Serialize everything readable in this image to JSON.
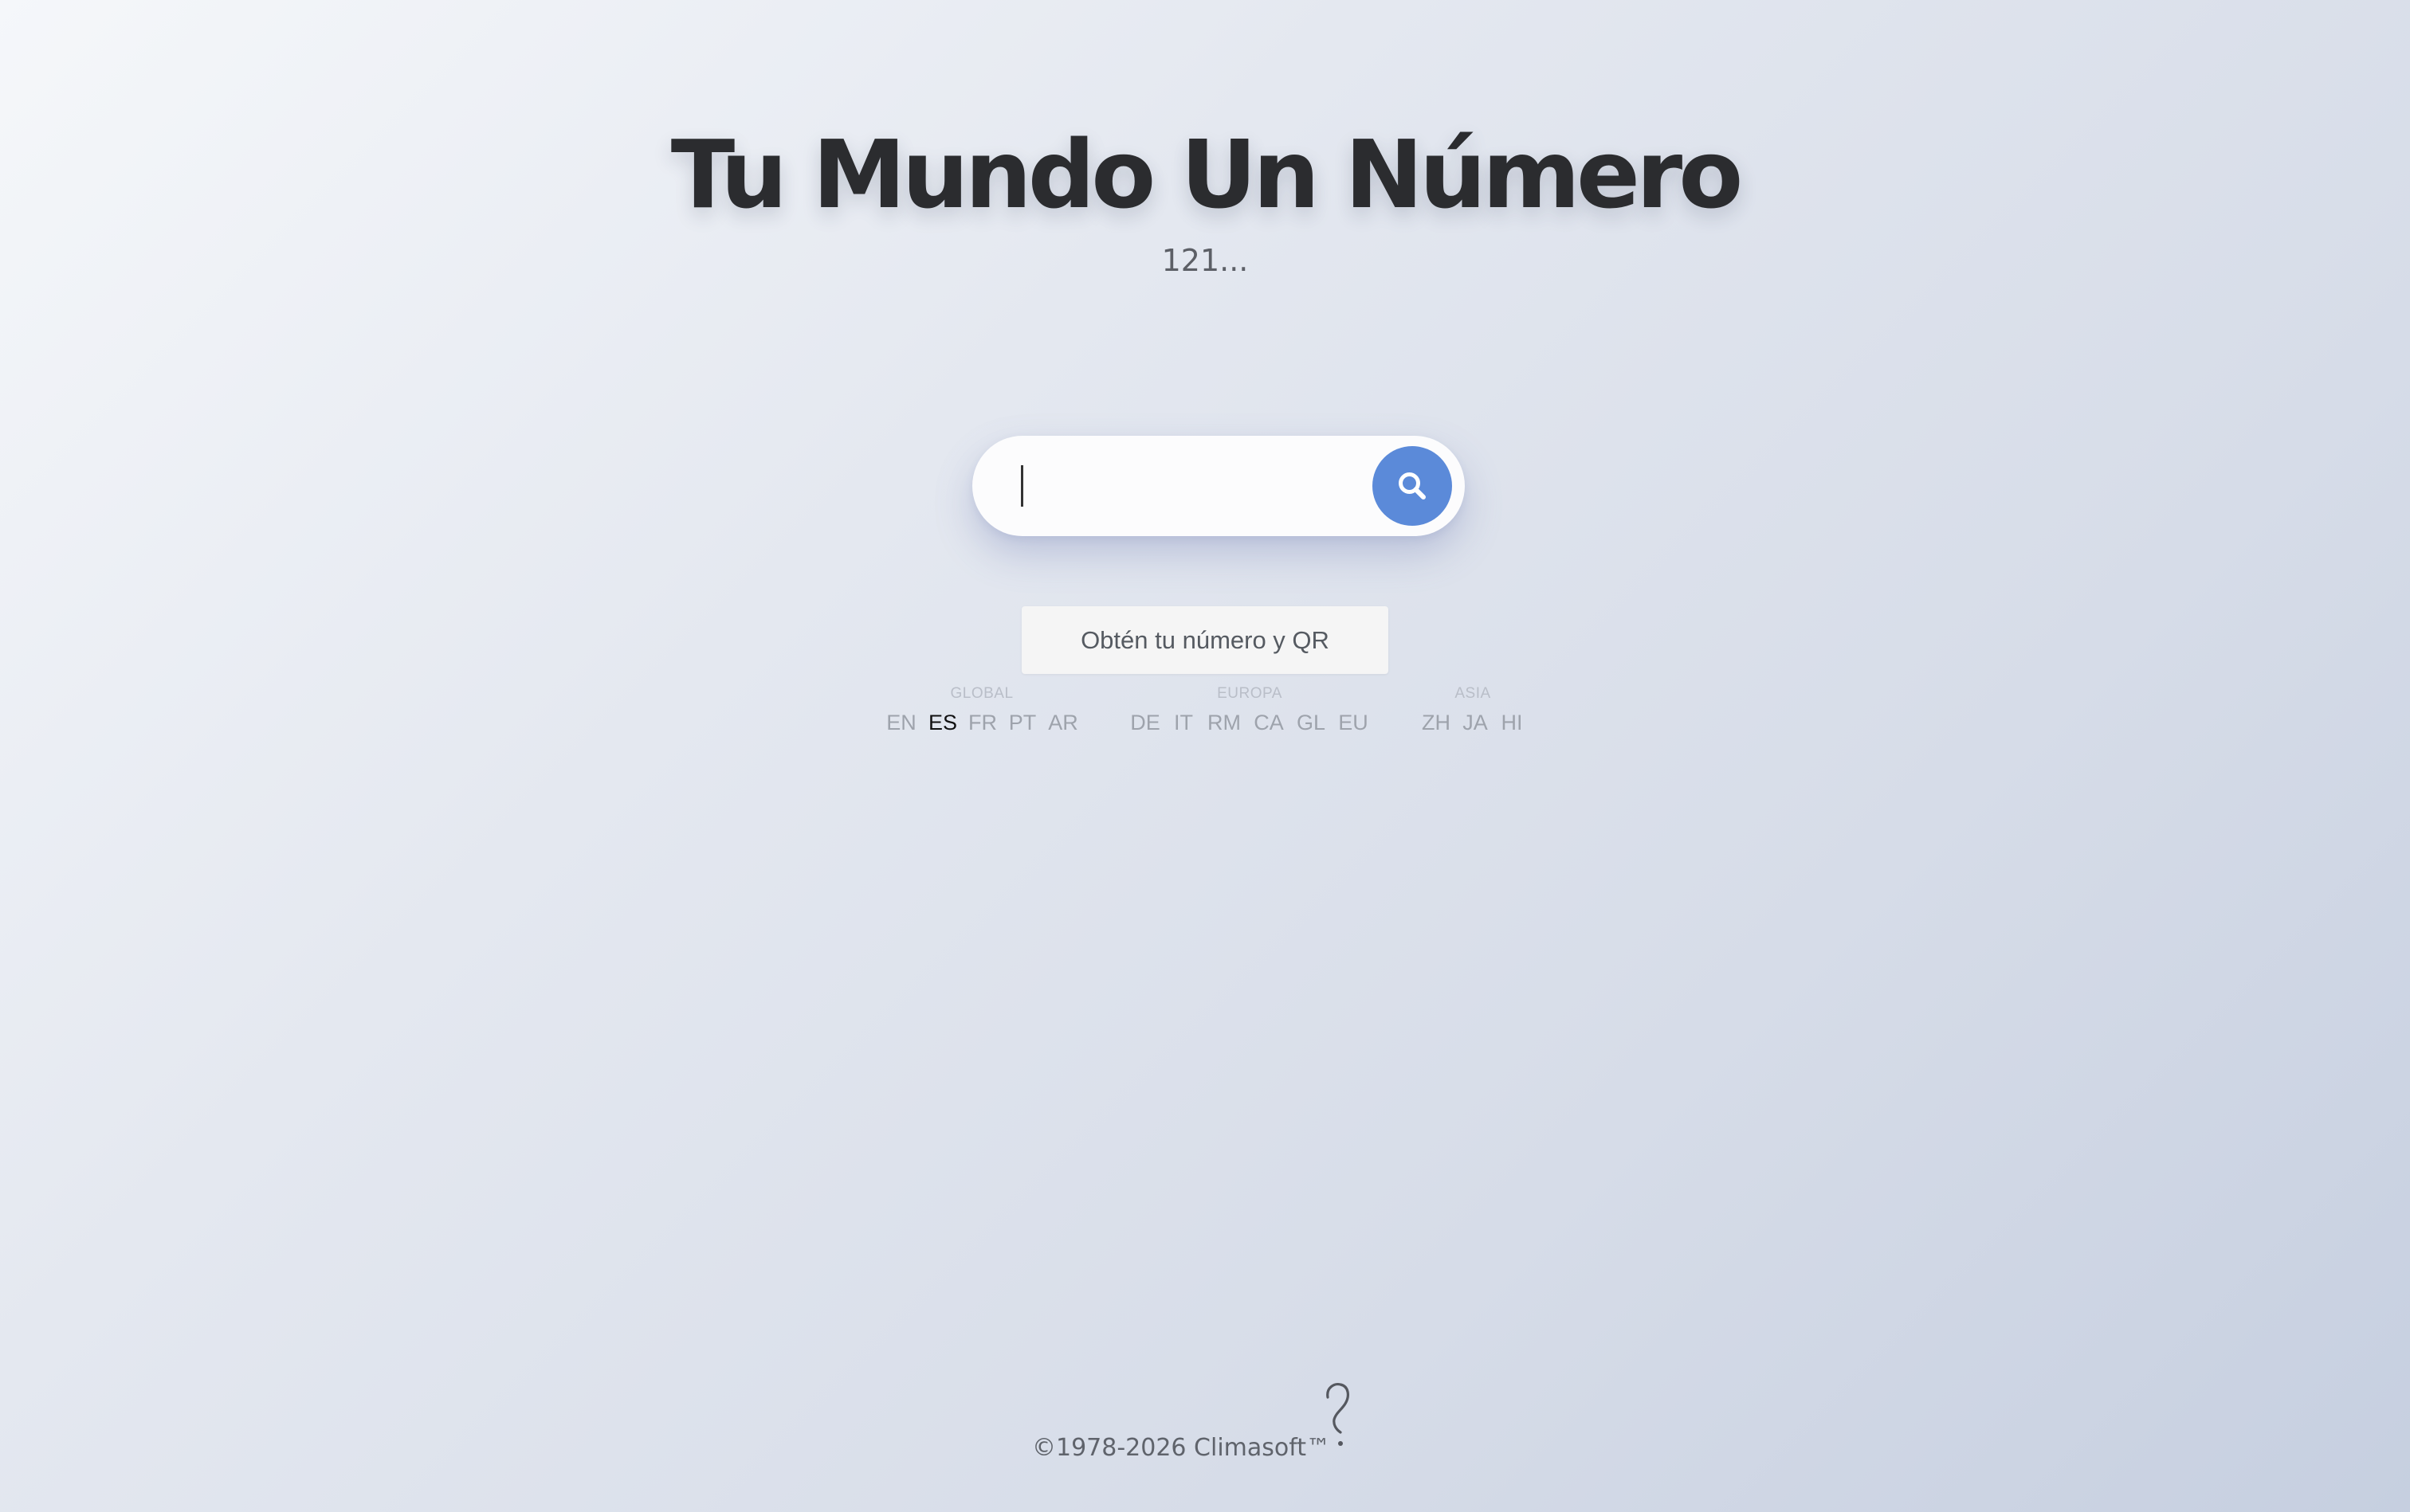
{
  "header": {
    "title": "Tu Mundo Un Número",
    "subtitle": "121..."
  },
  "search": {
    "value": "",
    "placeholder": "",
    "button_icon": "search-icon",
    "button_color": "#5b8ad9"
  },
  "cta": {
    "label": "Obtén tu número y QR"
  },
  "languages": {
    "groups": [
      {
        "label": "GLOBAL",
        "items": [
          "EN",
          "ES",
          "FR",
          "PT",
          "AR"
        ]
      },
      {
        "label": "EUROPA",
        "items": [
          "DE",
          "IT",
          "RM",
          "CA",
          "GL",
          "EU"
        ]
      },
      {
        "label": "ASIA",
        "items": [
          "ZH",
          "JA",
          "HI"
        ]
      }
    ],
    "selected": "ES"
  },
  "footer": {
    "copyright": "©1978-2026 Climasoft™",
    "help_icon": "question-mark-icon"
  }
}
